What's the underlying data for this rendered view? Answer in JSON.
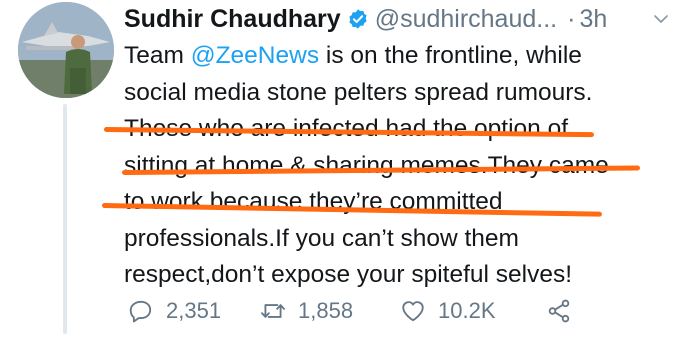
{
  "tweet": {
    "display_name": "Sudhir Chaudhary",
    "handle": "@sudhirchaud...",
    "separator": "·",
    "time": "3h",
    "text_lines": [
      {
        "pre": "Team ",
        "mention": "@ZeeNews",
        "post": " is on the frontline, while"
      },
      {
        "text": "social media stone pelters spread rumours."
      },
      {
        "text": "Those who are infected had the option of"
      },
      {
        "text": "sitting at home & sharing memes.They came"
      },
      {
        "text": "to work because they’re committed"
      },
      {
        "text": "professionals.If you can’t show them"
      },
      {
        "text": "respect,don’t expose your spiteful selves!"
      }
    ],
    "stats": {
      "replies": "2,351",
      "retweets": "1,858",
      "likes": "10.2K"
    }
  },
  "colors": {
    "mention": "#1da1f2",
    "secondary_text": "#657786",
    "verified": "#1da1f2",
    "annotation_underline": "#ff6a13"
  },
  "icons": [
    "avatar-photo",
    "verified-badge-icon",
    "chevron-down-icon",
    "reply-icon",
    "retweet-icon",
    "like-icon",
    "share-icon"
  ]
}
